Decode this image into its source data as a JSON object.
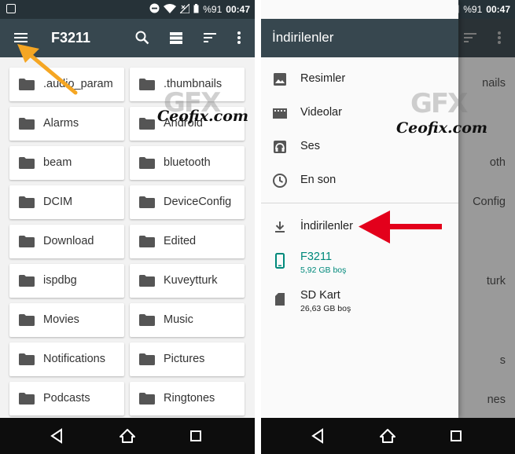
{
  "status_bar": {
    "battery": "%91",
    "time": "00:47"
  },
  "left_screen": {
    "toolbar_title": "F3211",
    "folders": [
      ".audio_param",
      ".thumbnails",
      "Alarms",
      "Android",
      "beam",
      "bluetooth",
      "DCIM",
      "DeviceConfig",
      "Download",
      "Edited",
      "ispdbg",
      "Kuveytturk",
      "Movies",
      "Music",
      "Notifications",
      "Pictures",
      "Podcasts",
      "Ringtones"
    ]
  },
  "right_screen": {
    "drawer_title": "İndirilenler",
    "items": [
      {
        "label": "Resimler",
        "icon": "image-icon"
      },
      {
        "label": "Videolar",
        "icon": "video-icon"
      },
      {
        "label": "Ses",
        "icon": "audio-icon"
      },
      {
        "label": "En son",
        "icon": "clock-icon"
      },
      {
        "label": "İndirilenler",
        "icon": "download-icon"
      },
      {
        "label": "F3211",
        "sub": "5,92 GB boş",
        "icon": "phone-storage-icon"
      },
      {
        "label": "SD Kart",
        "sub": "26,63 GB boş",
        "icon": "sd-card-icon"
      }
    ],
    "behind_labels": [
      "nails",
      "oth",
      "Config",
      "turk",
      "s",
      "nes"
    ]
  },
  "watermark": {
    "logo": "GFX",
    "text": "Ceofix.com"
  },
  "colors": {
    "toolbar": "#37474f",
    "status_bar": "#263238",
    "accent": "#00897b",
    "arrow_orange": "#f5a623",
    "arrow_red": "#e3001b"
  }
}
